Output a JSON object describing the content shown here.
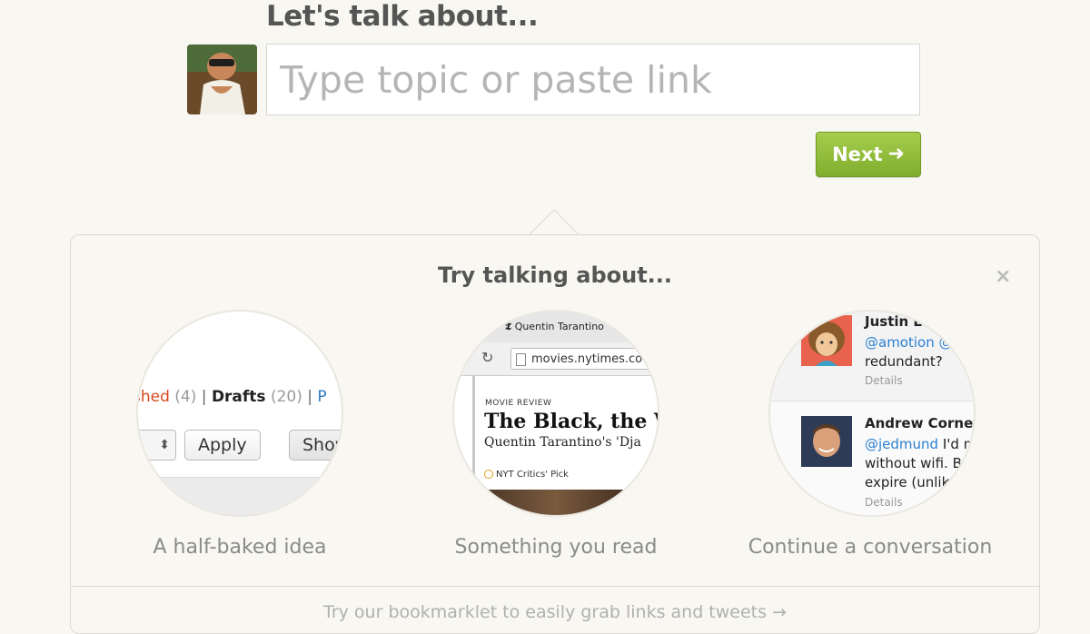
{
  "compose": {
    "heading": "Let's talk about...",
    "placeholder": "Type topic or paste link",
    "next_label": "Next"
  },
  "suggestions": {
    "title": "Try talking about...",
    "close_glyph": "×",
    "items": [
      {
        "caption": "A half-baked idea",
        "preview": {
          "published_label": "shed",
          "published_count": "(4)",
          "drafts_label": "Drafts",
          "drafts_count": "(20)",
          "next_tab_fragment": "P",
          "apply_label": "Apply",
          "show_label": "Show"
        }
      },
      {
        "caption": "Something you read",
        "preview": {
          "tab_title": "Quentin Tarantino",
          "url": "movies.nytimes.co",
          "section": "MOVIE REVIEW",
          "headline": "The Black, the W",
          "subhead": "Quentin Tarantino's 'Dja",
          "badge": "NYT Critics' Pick"
        }
      },
      {
        "caption": "Continue a conversation",
        "preview": {
          "tweets": [
            {
              "name": "Justin L",
              "handle": "@amotion @",
              "lines": [
                "redundant?"
              ],
              "details": "Details"
            },
            {
              "name": "Andrew Cornett",
              "handle": "@jedmund",
              "first_line": "I'd m",
              "lines": [
                "without wifi. Bo",
                "expire (unlike"
              ],
              "details": "Details"
            }
          ]
        }
      }
    ],
    "footer_link": "Try our bookmarklet to easily grab links and tweets →"
  },
  "colors": {
    "accent_green": "#8bbb38",
    "background": "#f8f7f2"
  }
}
